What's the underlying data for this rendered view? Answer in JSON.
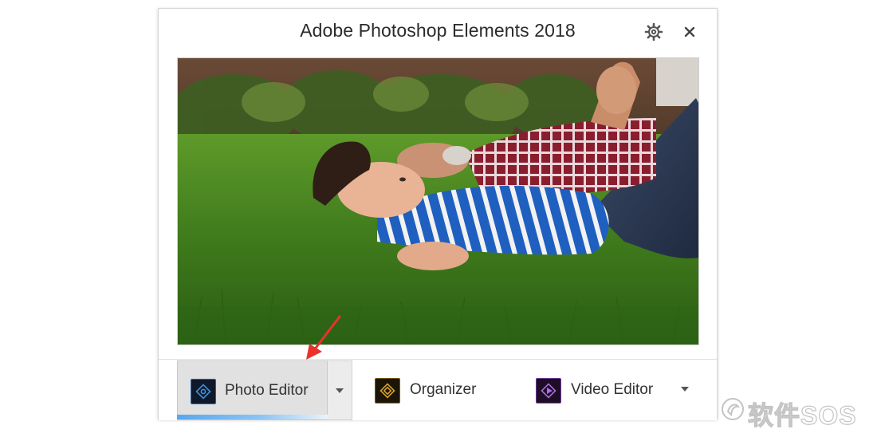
{
  "window": {
    "title": "Adobe Photoshop Elements 2018",
    "settings_icon": "gear-icon",
    "close_icon": "close-icon"
  },
  "hero_image": {
    "subject": "boy and grandfather lying on grass"
  },
  "apps": {
    "photo_editor": {
      "label": "Photo Editor",
      "icon": "photo-editor-icon",
      "selected": true,
      "loading_progress": 1.0
    },
    "organizer": {
      "label": "Organizer",
      "icon": "organizer-icon"
    },
    "video_editor": {
      "label": "Video Editor",
      "icon": "video-editor-icon"
    }
  },
  "colors": {
    "accent_blue": "#5aa7ec",
    "annotation_arrow": "#e8322b",
    "selected_bg": "#e1e1e1"
  },
  "watermark": {
    "text": "软件SOS"
  }
}
